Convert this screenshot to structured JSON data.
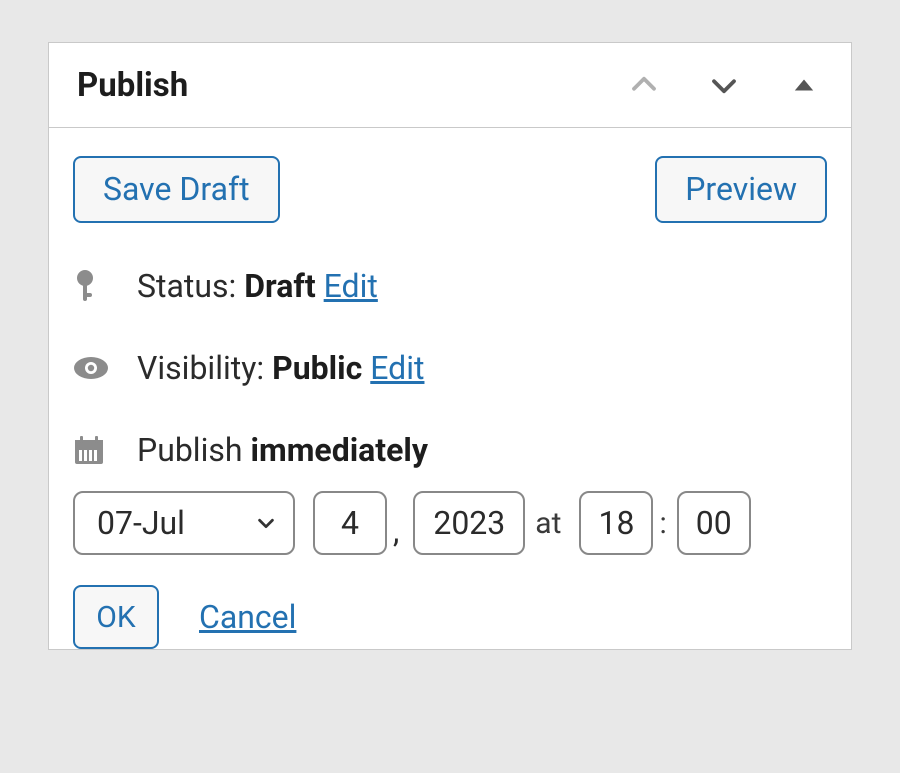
{
  "panel": {
    "title": "Publish",
    "actions": {
      "save_draft": "Save Draft",
      "preview": "Preview"
    },
    "status": {
      "icon": "key-icon",
      "label": "Status:",
      "value": "Draft",
      "edit": "Edit"
    },
    "visibility": {
      "icon": "eye-icon",
      "label": "Visibility:",
      "value": "Public",
      "edit": "Edit"
    },
    "schedule": {
      "icon": "calendar-icon",
      "label": "Publish",
      "value": "immediately",
      "month": "07-Jul",
      "day": "4",
      "year": "2023",
      "at": "at",
      "hour": "18",
      "minute": "00",
      "ok": "OK",
      "cancel": "Cancel"
    }
  }
}
